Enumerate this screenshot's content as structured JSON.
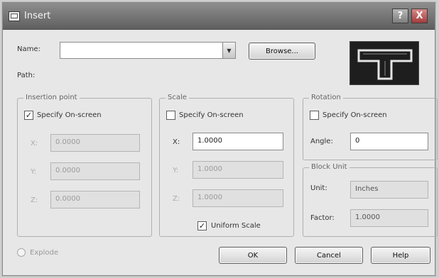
{
  "window": {
    "title": "Insert",
    "help_glyph": "?",
    "close_glyph": "X"
  },
  "name": {
    "label": "Name:",
    "value": "",
    "combo_glyph": "▼"
  },
  "browse_label": "Browse...",
  "path_label": "Path:",
  "insertion_point": {
    "title": "Insertion point",
    "specify_label": "Specify On-screen",
    "specify_checked": true,
    "x_label": "X:",
    "x_value": "0.0000",
    "y_label": "Y:",
    "y_value": "0.0000",
    "z_label": "Z:",
    "z_value": "0.0000"
  },
  "scale": {
    "title": "Scale",
    "specify_label": "Specify On-screen",
    "specify_checked": false,
    "x_label": "X:",
    "x_value": "1.0000",
    "y_label": "Y:",
    "y_value": "1.0000",
    "z_label": "Z:",
    "z_value": "1.0000",
    "uniform_label": "Uniform Scale",
    "uniform_checked": true
  },
  "rotation": {
    "title": "Rotation",
    "specify_label": "Specify On-screen",
    "specify_checked": false,
    "angle_label": "Angle:",
    "angle_value": "0"
  },
  "block_unit": {
    "title": "Block Unit",
    "unit_label": "Unit:",
    "unit_value": "Inches",
    "factor_label": "Factor:",
    "factor_value": "1.0000"
  },
  "explode_label": "Explode",
  "buttons": {
    "ok": "OK",
    "cancel": "Cancel",
    "help": "Help"
  },
  "check_glyph": "✓"
}
